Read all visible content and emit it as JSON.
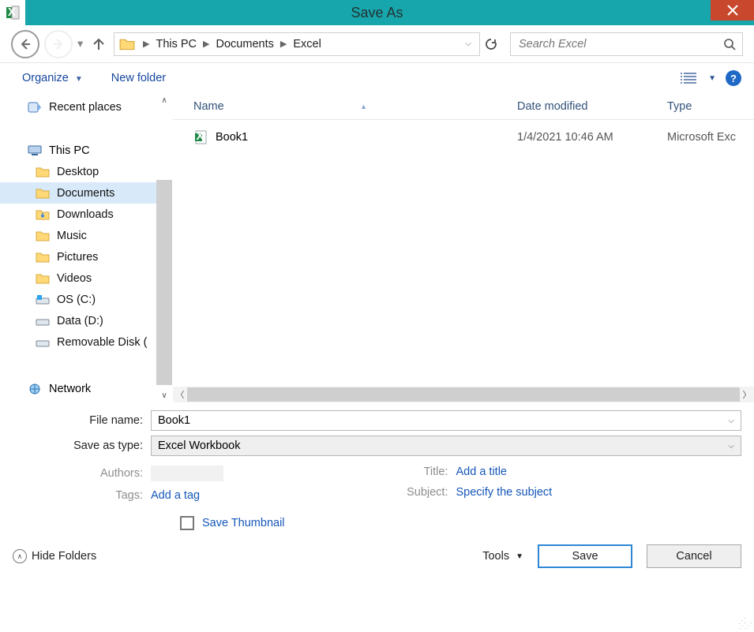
{
  "window": {
    "title": "Save As"
  },
  "nav": {
    "breadcrumb": [
      "This PC",
      "Documents",
      "Excel"
    ],
    "search_placeholder": "Search Excel"
  },
  "toolbar": {
    "organize": "Organize",
    "new_folder": "New folder"
  },
  "tree": {
    "recent_places": "Recent places",
    "this_pc": "This PC",
    "items": [
      {
        "label": "Desktop"
      },
      {
        "label": "Documents",
        "selected": true
      },
      {
        "label": "Downloads"
      },
      {
        "label": "Music"
      },
      {
        "label": "Pictures"
      },
      {
        "label": "Videos"
      },
      {
        "label": "OS (C:)"
      },
      {
        "label": "Data (D:)"
      },
      {
        "label": "Removable Disk ("
      }
    ],
    "network": "Network"
  },
  "columns": {
    "name": "Name",
    "date": "Date modified",
    "type": "Type"
  },
  "files": [
    {
      "name": "Book1",
      "date": "1/4/2021 10:46 AM",
      "type": "Microsoft Exc"
    }
  ],
  "form": {
    "file_name_label": "File name:",
    "file_name_value": "Book1",
    "save_as_type_label": "Save as type:",
    "save_as_type_value": "Excel Workbook",
    "meta": {
      "authors_label": "Authors:",
      "tags_label": "Tags:",
      "tags_link": "Add a tag",
      "title_label": "Title:",
      "title_link": "Add a title",
      "subject_label": "Subject:",
      "subject_link": "Specify the subject"
    },
    "save_thumbnail": "Save Thumbnail"
  },
  "footer": {
    "hide_folders": "Hide Folders",
    "tools": "Tools",
    "save": "Save",
    "cancel": "Cancel"
  }
}
